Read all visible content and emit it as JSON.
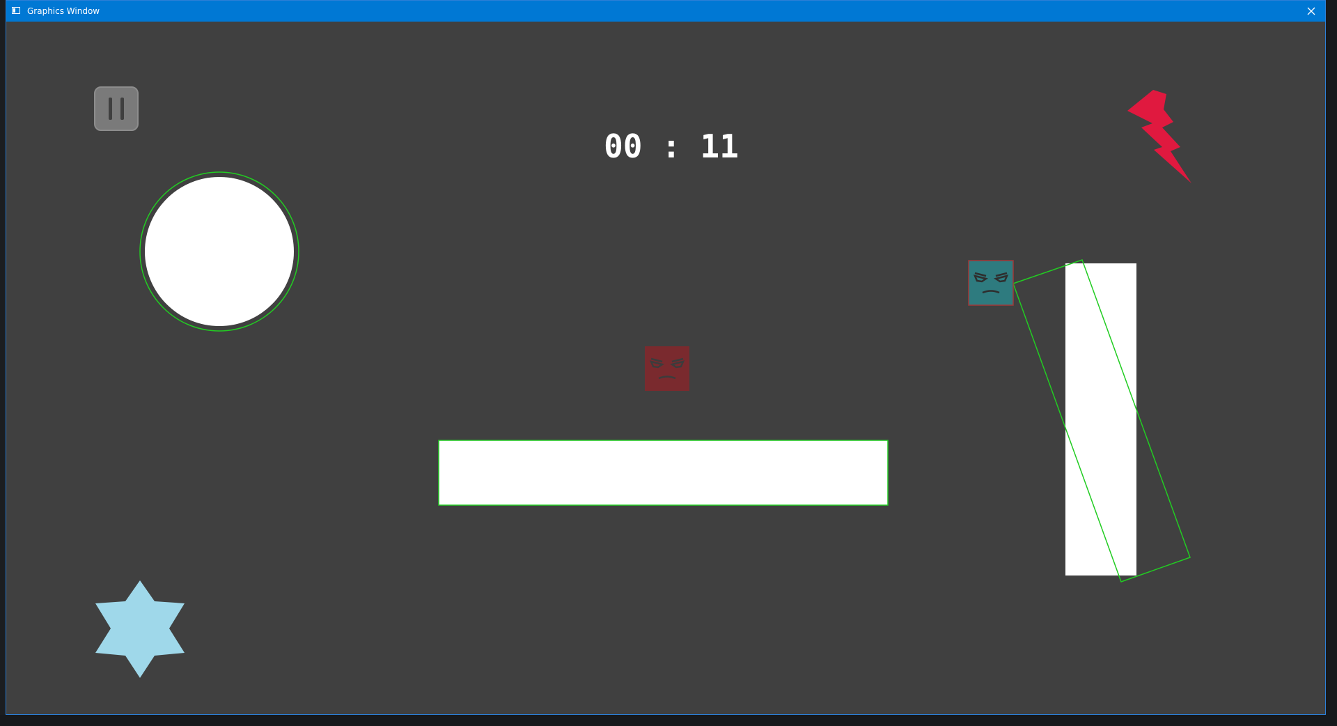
{
  "window": {
    "title": "Graphics Window",
    "close_icon": "close-icon",
    "app_icon": "window-icon"
  },
  "hud": {
    "pause_icon": "pause-icon",
    "timer_text": "00 : 11"
  },
  "scene": {
    "background_color": "#404040",
    "outline_color": "#22cc22",
    "ball_color": "#ffffff",
    "platform_color": "#ffffff",
    "pillar_color": "#ffffff",
    "enemy_red_color": "#7a2a2e",
    "enemy_teal_color": "#2e7b7f",
    "lightning_color": "#e0193f",
    "star_color": "#9fd8ea",
    "icons": {
      "lightning": "lightning-bolt-icon",
      "star": "six-point-star-icon",
      "enemy_face": "angry-face-icon"
    }
  }
}
